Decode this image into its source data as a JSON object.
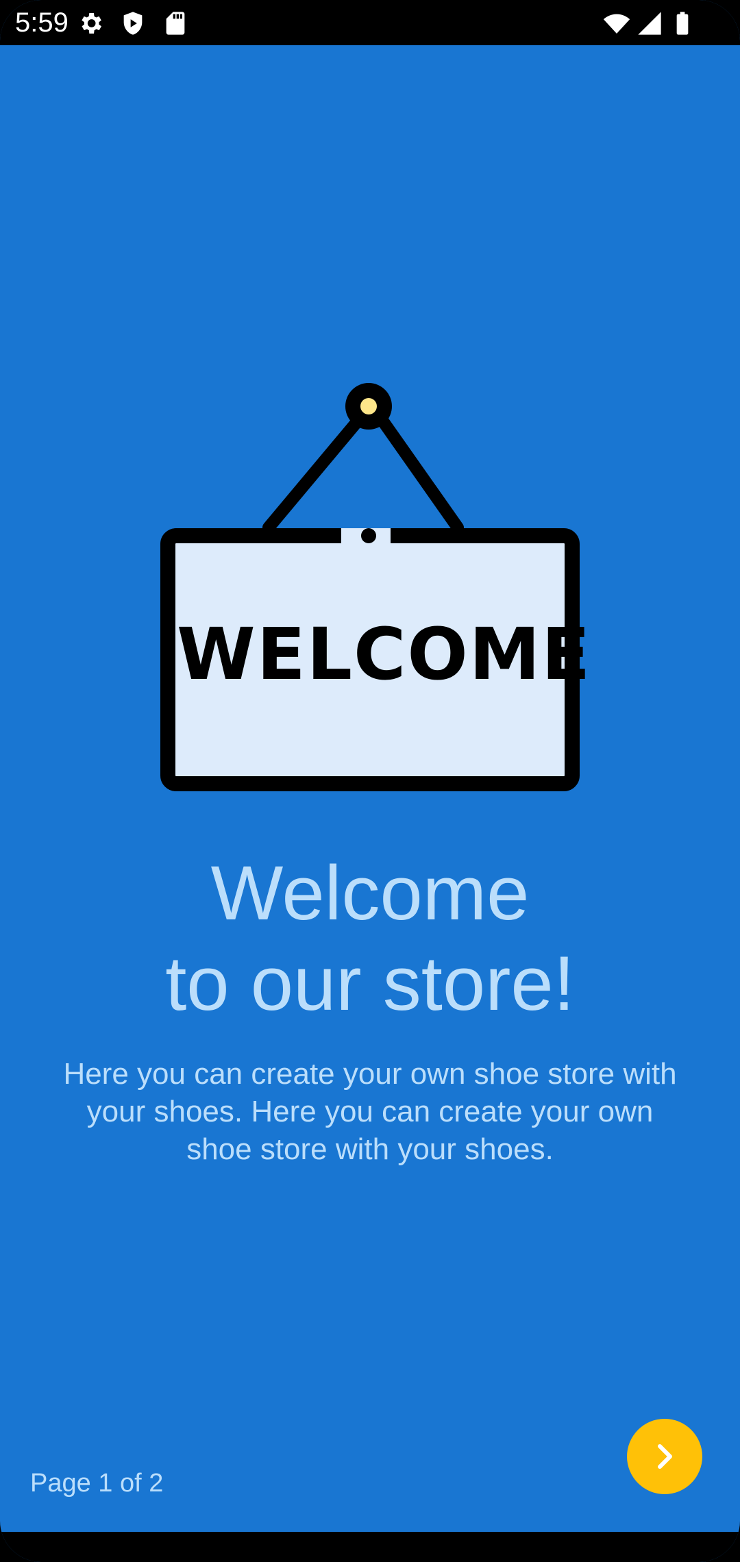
{
  "status_bar": {
    "time": "5:59",
    "left_icons": [
      "gear-icon",
      "shield-icon",
      "sd-card-icon"
    ],
    "right_icons": [
      "wifi-icon",
      "cellular-signal-icon",
      "battery-icon"
    ]
  },
  "illustration": {
    "icon": "welcome-sign-icon",
    "sign_text": "WELCOME",
    "colors": {
      "board": "#DDEBFB",
      "outline": "#000000",
      "nail": "#FDE68A"
    }
  },
  "content": {
    "title_line1": "Welcome",
    "title_line2": "to our store!",
    "description": "Here you can create your own shoe store with your shoes. Here you can create your own shoe store with your shoes."
  },
  "footer": {
    "page_indicator": "Page 1 of 2",
    "next_button_icon": "chevron-right-icon"
  },
  "colors": {
    "background": "#1976D2",
    "text": "#BBDEFB",
    "accent": "#FFC107"
  }
}
